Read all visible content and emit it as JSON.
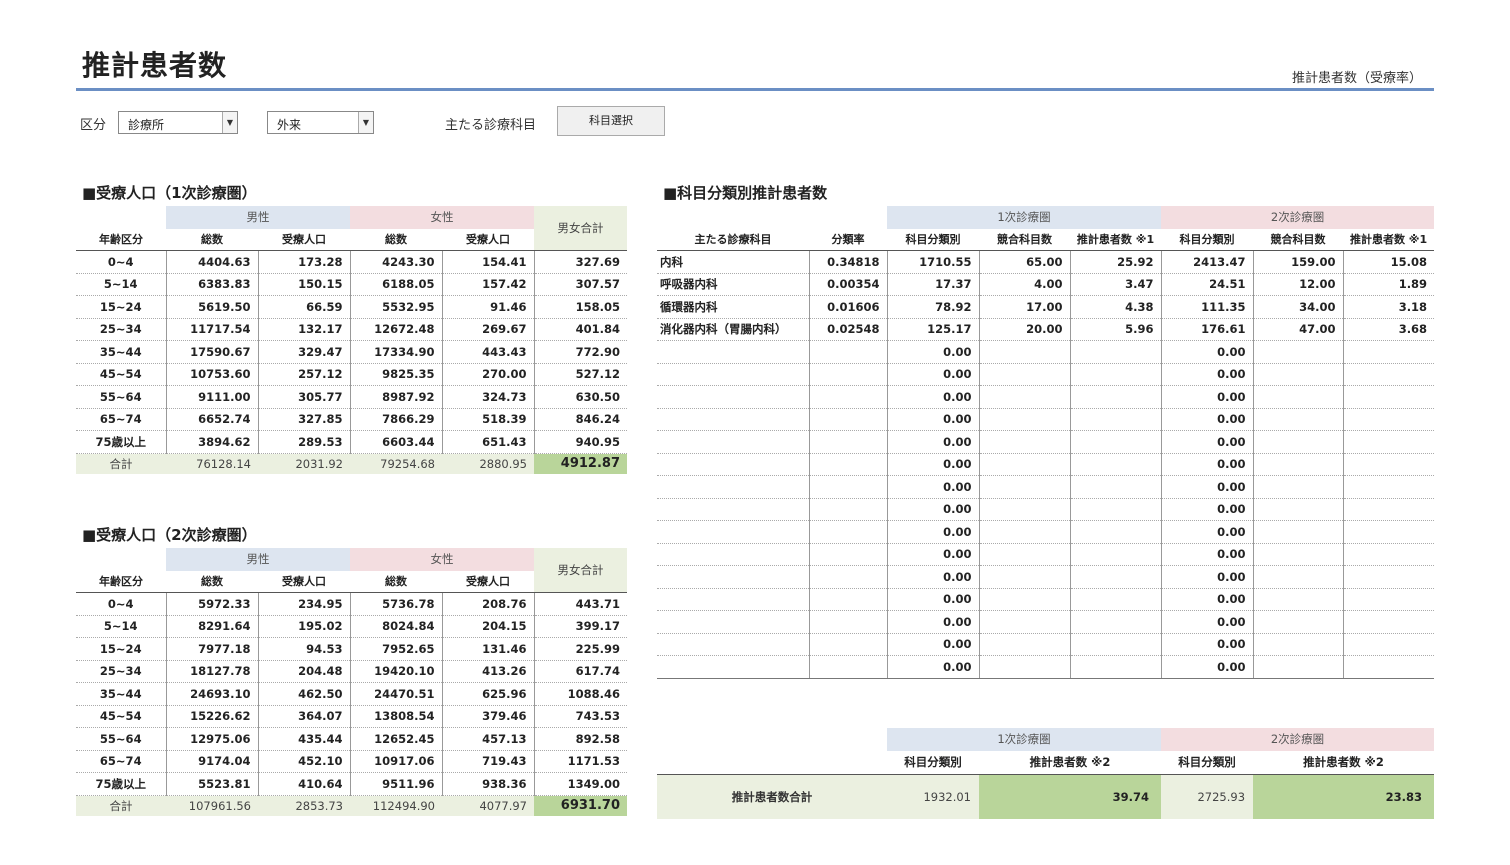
{
  "header": {
    "title": "推計患者数",
    "subtitle": "推計患者数（受療率）"
  },
  "filters": {
    "category_label": "区分",
    "facility_value": "診療所",
    "type_value": "外来",
    "subject_label": "主たる診療科目",
    "subject_button": "科目選択"
  },
  "pop_common": {
    "male": "男性",
    "female": "女性",
    "total": "男女合計",
    "age_group": "年齢区分",
    "total_pop": "総数",
    "patient_pop": "受療人口",
    "sum_label": "合計"
  },
  "pop1": {
    "title": "■受療人口（1次診療圏）",
    "rows": [
      [
        "0~4",
        "4404.63",
        "173.28",
        "4243.30",
        "154.41",
        "327.69"
      ],
      [
        "5~14",
        "6383.83",
        "150.15",
        "6188.05",
        "157.42",
        "307.57"
      ],
      [
        "15~24",
        "5619.50",
        "66.59",
        "5532.95",
        "91.46",
        "158.05"
      ],
      [
        "25~34",
        "11717.54",
        "132.17",
        "12672.48",
        "269.67",
        "401.84"
      ],
      [
        "35~44",
        "17590.67",
        "329.47",
        "17334.90",
        "443.43",
        "772.90"
      ],
      [
        "45~54",
        "10753.60",
        "257.12",
        "9825.35",
        "270.00",
        "527.12"
      ],
      [
        "55~64",
        "9111.00",
        "305.77",
        "8987.92",
        "324.73",
        "630.50"
      ],
      [
        "65~74",
        "6652.74",
        "327.85",
        "7866.29",
        "518.39",
        "846.24"
      ],
      [
        "75歳以上",
        "3894.62",
        "289.53",
        "6603.44",
        "651.43",
        "940.95"
      ]
    ],
    "totals": [
      "76128.14",
      "2031.92",
      "79254.68",
      "2880.95",
      "4912.87"
    ]
  },
  "pop2": {
    "title": "■受療人口（2次診療圏）",
    "rows": [
      [
        "0~4",
        "5972.33",
        "234.95",
        "5736.78",
        "208.76",
        "443.71"
      ],
      [
        "5~14",
        "8291.64",
        "195.02",
        "8024.84",
        "204.15",
        "399.17"
      ],
      [
        "15~24",
        "7977.18",
        "94.53",
        "7952.65",
        "131.46",
        "225.99"
      ],
      [
        "25~34",
        "18127.78",
        "204.48",
        "19420.10",
        "413.26",
        "617.74"
      ],
      [
        "35~44",
        "24693.10",
        "462.50",
        "24470.51",
        "625.96",
        "1088.46"
      ],
      [
        "45~54",
        "15226.62",
        "364.07",
        "13808.54",
        "379.46",
        "743.53"
      ],
      [
        "55~64",
        "12975.06",
        "435.44",
        "12652.45",
        "457.13",
        "892.58"
      ],
      [
        "65~74",
        "9174.04",
        "452.10",
        "10917.06",
        "719.43",
        "1171.53"
      ],
      [
        "75歳以上",
        "5523.81",
        "410.64",
        "9511.96",
        "938.36",
        "1349.00"
      ]
    ],
    "totals": [
      "107961.56",
      "2853.73",
      "112494.90",
      "4077.97",
      "6931.70"
    ]
  },
  "subjects": {
    "title": "■科目分類別推計患者数",
    "area1": "1次診療圏",
    "area2": "2次診療圏",
    "col_subject": "主たる診療科目",
    "col_rate": "分類率",
    "col_class": "科目分類別",
    "col_compete": "競合科目数",
    "col_estimate": "推計患者数 ※1",
    "rows": [
      [
        "内科",
        "0.34818",
        "1710.55",
        "65.00",
        "25.92",
        "2413.47",
        "159.00",
        "15.08"
      ],
      [
        "呼吸器内科",
        "0.00354",
        "17.37",
        "4.00",
        "3.47",
        "24.51",
        "12.00",
        "1.89"
      ],
      [
        "循環器内科",
        "0.01606",
        "78.92",
        "17.00",
        "4.38",
        "111.35",
        "34.00",
        "3.18"
      ],
      [
        "消化器内科（胃腸内科）",
        "0.02548",
        "125.17",
        "20.00",
        "5.96",
        "176.61",
        "47.00",
        "3.68"
      ],
      [
        "",
        "",
        "0.00",
        "",
        "",
        "0.00",
        "",
        ""
      ],
      [
        "",
        "",
        "0.00",
        "",
        "",
        "0.00",
        "",
        ""
      ],
      [
        "",
        "",
        "0.00",
        "",
        "",
        "0.00",
        "",
        ""
      ],
      [
        "",
        "",
        "0.00",
        "",
        "",
        "0.00",
        "",
        ""
      ],
      [
        "",
        "",
        "0.00",
        "",
        "",
        "0.00",
        "",
        ""
      ],
      [
        "",
        "",
        "0.00",
        "",
        "",
        "0.00",
        "",
        ""
      ],
      [
        "",
        "",
        "0.00",
        "",
        "",
        "0.00",
        "",
        ""
      ],
      [
        "",
        "",
        "0.00",
        "",
        "",
        "0.00",
        "",
        ""
      ],
      [
        "",
        "",
        "0.00",
        "",
        "",
        "0.00",
        "",
        ""
      ],
      [
        "",
        "",
        "0.00",
        "",
        "",
        "0.00",
        "",
        ""
      ],
      [
        "",
        "",
        "0.00",
        "",
        "",
        "0.00",
        "",
        ""
      ],
      [
        "",
        "",
        "0.00",
        "",
        "",
        "0.00",
        "",
        ""
      ],
      [
        "",
        "",
        "0.00",
        "",
        "",
        "0.00",
        "",
        ""
      ],
      [
        "",
        "",
        "0.00",
        "",
        "",
        "0.00",
        "",
        ""
      ],
      [
        "",
        "",
        "0.00",
        "",
        "",
        "0.00",
        "",
        ""
      ]
    ]
  },
  "summary": {
    "area1": "1次診療圏",
    "area2": "2次診療圏",
    "col_class": "科目分類別",
    "col_estimate": "推計患者数 ※2",
    "label": "推計患者数合計",
    "values": [
      "1932.01",
      "39.74",
      "2725.93",
      "23.83"
    ]
  }
}
